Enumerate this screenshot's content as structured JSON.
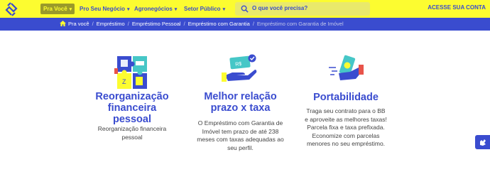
{
  "header": {
    "nav": [
      {
        "label": "Pra Você",
        "active": true
      },
      {
        "label": "Pro Seu Negócio"
      },
      {
        "label": "Agronegócios"
      },
      {
        "label": "Setor Público"
      }
    ],
    "search_placeholder": "O que você precisa?",
    "account_label": "ACESSE SUA CONTA"
  },
  "breadcrumb": [
    "Pra você",
    "Empréstimo",
    "Empréstimo Pessoal",
    "Empréstimo com Garantia",
    "Empréstimo com Garantia de Imóvel"
  ],
  "cards": [
    {
      "title": "Reorganização financeira pessoal",
      "text": "Reorganização financeira pessoal",
      "icon": "puzzle-icon"
    },
    {
      "title": "Melhor relação prazo x taxa",
      "text": "O Empréstimo com Garantia de Imóvel tem prazo de até 238 meses com taxas adequadas ao seu perfil.",
      "icon": "money-hand-icon"
    },
    {
      "title": "Portabilidade",
      "text": "Traga seu contrato para o BB e aproveite as melhores taxas! Parcela fixa e taxa prefixada. Economize com parcelas menores no seu empréstimo.",
      "icon": "money-phone-icon"
    }
  ],
  "colors": {
    "brand_yellow": "#fcfc30",
    "brand_blue": "#3a4ccf"
  }
}
